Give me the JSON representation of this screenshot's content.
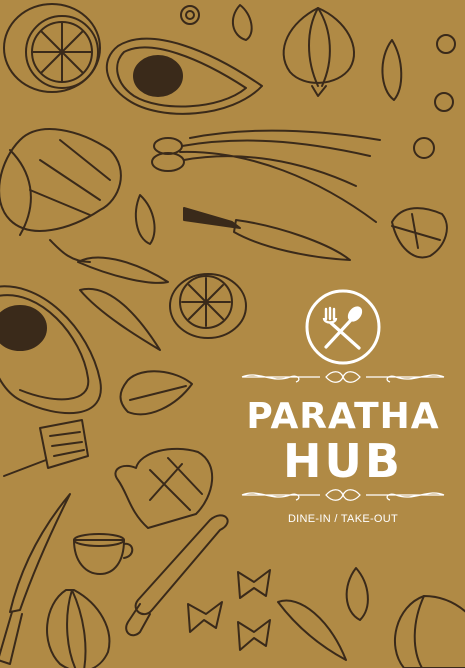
{
  "brand": {
    "name_line_1": "PARATHA",
    "name_line_2": "HUB",
    "tagline": "DINE-IN / TAKE-OUT",
    "emblem_icon": "fork-spoon-icon"
  },
  "colors": {
    "background": "#b08a45",
    "ink": "#3a2a1a",
    "logo": "#ffffff"
  }
}
